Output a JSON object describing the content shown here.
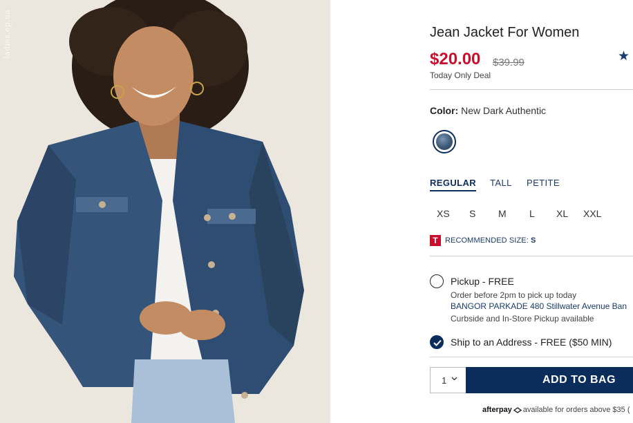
{
  "product": {
    "title": "Jean Jacket For Women",
    "price": "$20.00",
    "original_price": "$39.99",
    "deal_label": "Today Only Deal",
    "rating_icon": "star-icon"
  },
  "photo": {
    "watermark": "ladies.ep.ua",
    "icon": "model-photo"
  },
  "color": {
    "label": "Color:",
    "value": "New Dark Authentic"
  },
  "fit_tabs": [
    {
      "label": "REGULAR",
      "active": true
    },
    {
      "label": "TALL",
      "active": false
    },
    {
      "label": "PETITE",
      "active": false
    }
  ],
  "sizes": [
    "XS",
    "S",
    "M",
    "L",
    "XL",
    "XXL"
  ],
  "recommended": {
    "badge": "T",
    "text": "RECOMMENDED SIZE:",
    "size": "S"
  },
  "fulfillment": {
    "pickup": {
      "label": "Pickup - FREE",
      "note": "Order before 2pm to pick up today",
      "store": "BANGOR PARKADE 480 Stillwater Avenue  Ban",
      "extra": "Curbside and In-Store Pickup available",
      "selected": false
    },
    "ship": {
      "label": "Ship to an Address - FREE ($50 MIN)",
      "selected": true
    }
  },
  "cart": {
    "quantity": "1",
    "add_label": "ADD TO BAG"
  },
  "afterpay": {
    "logo": "afterpay",
    "text": "available for orders above $35 ("
  },
  "colors": {
    "navy": "#0b2d5c",
    "sale_red": "#c8102e",
    "link_blue": "#1a3a6b"
  }
}
